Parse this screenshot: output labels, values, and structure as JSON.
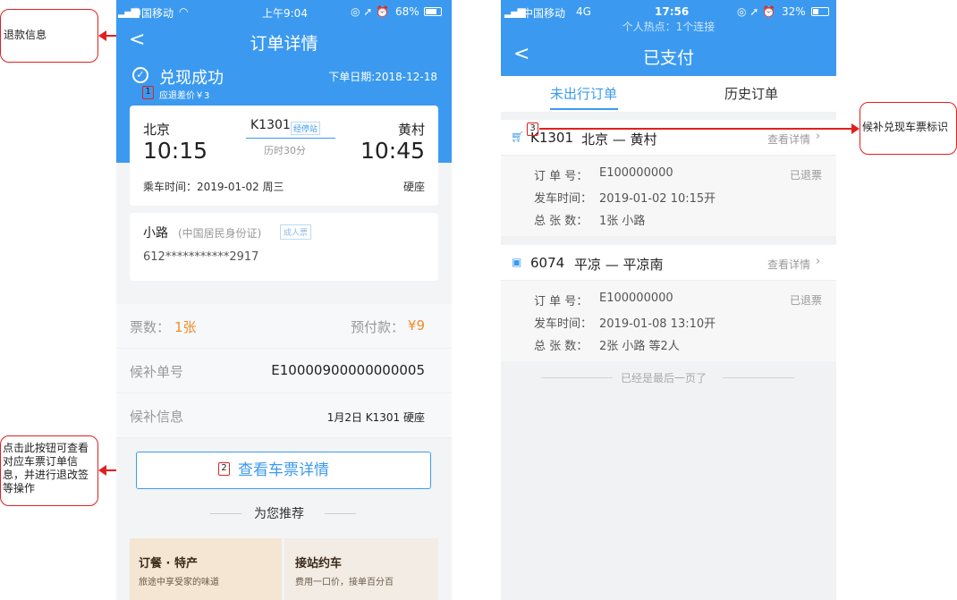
{
  "annotations": {
    "refund_info": "退款信息",
    "view_ticket_help": "点击此按钮可查看对应车票订单信息，并进行退改签等操作",
    "candidate_mark": "候补兑现车票标识",
    "n1": "1",
    "n2": "2",
    "n3": "3"
  },
  "left": {
    "status": {
      "carrier": "中国移动",
      "time": "上午9:04",
      "battery": "68%"
    },
    "title": "订单详情",
    "success_text": "兑现成功",
    "refund_diff": "应退差价￥3",
    "order_date": "下单日期:2018-12-18",
    "trip": {
      "from": "北京",
      "to": "黄村",
      "train": "K1301",
      "via_tag": "经停站",
      "dep": "10:15",
      "arr": "10:45",
      "duration": "历时30分",
      "ride_time": "乘车时间：2019-01-02 周三",
      "seat": "硬座"
    },
    "passenger": {
      "name": "小路",
      "id_type": "(中国居民身份证)",
      "tag": "成人票",
      "id_no": "612***********2917"
    },
    "tickets_label": "票数：",
    "tickets_value": "1张",
    "prepay_label": "预付款：",
    "prepay_value": "¥9",
    "cand_no_label": "候补单号",
    "cand_no_value": "E10000900000000005",
    "cand_info_label": "候补信息",
    "cand_info_value": "1月2日 K1301 硬座",
    "view_button": "查看车票详情",
    "recommend": "为您推荐",
    "promo1_title": "订餐 · 特产",
    "promo1_sub": "旅途中享受家的味道",
    "promo2_title": "接站约车",
    "promo2_sub": "费用一口价，接单百分百"
  },
  "right": {
    "status": {
      "carrier": "中国移动",
      "net": "4G",
      "time": "17:56",
      "battery": "32%",
      "hotspot": "个人热点：1个连接"
    },
    "title": "已支付",
    "tab_active": "未出行订单",
    "tab_other": "历史订单",
    "orders": [
      {
        "train": "K1301",
        "route": "北京 — 黄村",
        "detail": "查看详情",
        "order_label": "订 单 号：",
        "order_no": "E100000000",
        "state": "已退票",
        "time_label": "发车时间：",
        "time": "2019-01-02  10:15开",
        "count_label": "总 张 数：",
        "count": "1张  小路"
      },
      {
        "train": "6074",
        "route": "平凉 — 平凉南",
        "detail": "查看详情",
        "order_label": "订 单 号：",
        "order_no": "E100000000",
        "state": "已退票",
        "time_label": "发车时间：",
        "time": "2019-01-08  13:10开",
        "count_label": "总 张 数：",
        "count": "2张  小路 等2人"
      }
    ],
    "last_page": "已经是最后一页了"
  }
}
